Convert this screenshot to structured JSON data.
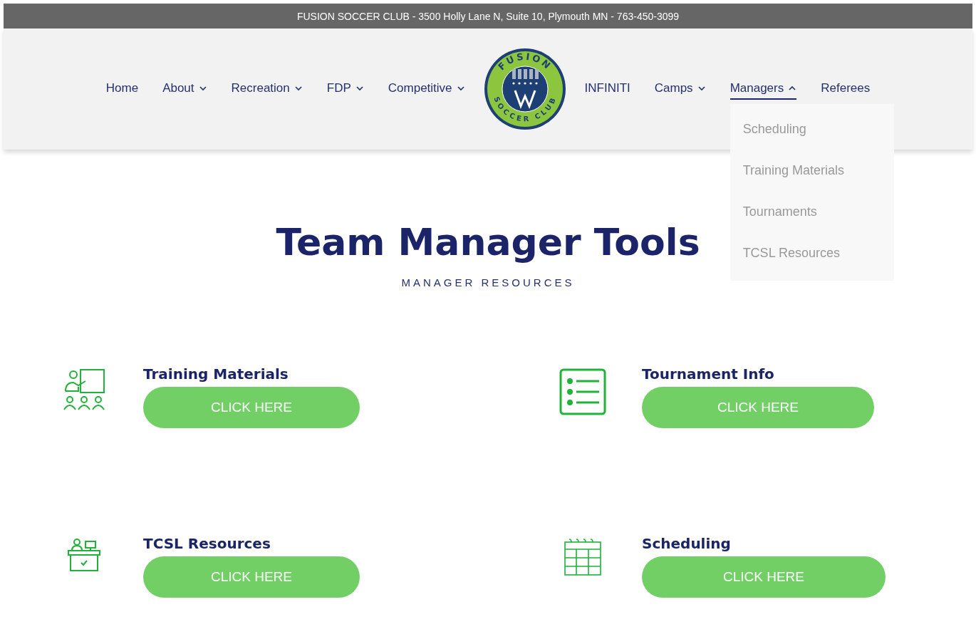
{
  "top_bar": {
    "text": "FUSION SOCCER CLUB - 3500 Holly Lane N, Suite 10, Plymouth MN - 763-450-3099"
  },
  "nav": {
    "left_items": [
      {
        "label": "Home",
        "has_menu": false,
        "expanded": false
      },
      {
        "label": "About",
        "has_menu": true,
        "expanded": false
      },
      {
        "label": "Recreation",
        "has_menu": true,
        "expanded": false
      },
      {
        "label": "FDP",
        "has_menu": true,
        "expanded": false
      },
      {
        "label": "Competitive",
        "has_menu": true,
        "expanded": false
      }
    ],
    "logo": {
      "top_text": "FUSION",
      "bottom_text": "SOCCER CLUB"
    },
    "right_items": [
      {
        "label": "INFINITI",
        "has_menu": false,
        "expanded": false
      },
      {
        "label": "Camps",
        "has_menu": true,
        "expanded": false
      },
      {
        "label": "Managers",
        "has_menu": true,
        "expanded": true,
        "submenu": [
          "Scheduling",
          "Training Materials",
          "Tournaments",
          "TCSL Resources"
        ]
      },
      {
        "label": "Referees",
        "has_menu": false,
        "expanded": false
      }
    ]
  },
  "page": {
    "title": "Team Manager Tools",
    "subtitle": "MANAGER RESOURCES"
  },
  "cards": [
    {
      "kind": "presentation",
      "title": "Training Materials",
      "button": "CLICK HERE"
    },
    {
      "kind": "list",
      "title": "Tournament Info",
      "button": "CLICK HERE"
    },
    {
      "kind": "desk",
      "title": "TCSL Resources",
      "button": "CLICK HERE"
    },
    {
      "kind": "calendar",
      "title": "Scheduling",
      "button": "CLICK HERE"
    }
  ]
}
